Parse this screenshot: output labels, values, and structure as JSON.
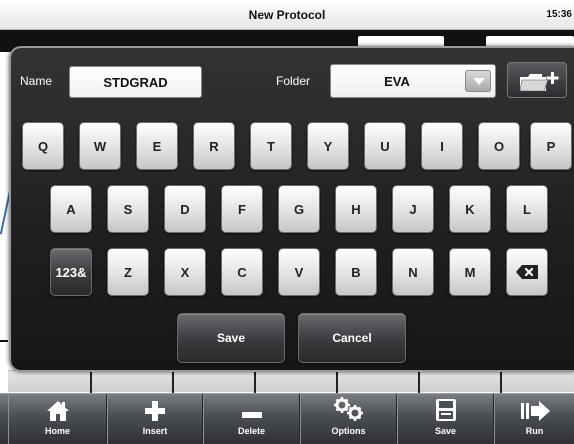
{
  "window": {
    "title": "New Protocol",
    "clock": "15:36"
  },
  "dialog": {
    "name_label": "Name",
    "name_value": "STDGRAD",
    "folder_label": "Folder",
    "folder_value": "EVA",
    "icons": {
      "dropdown": "chevron-down-icon",
      "new_folder": "new-folder-icon"
    }
  },
  "keyboard": {
    "row1": [
      "Q",
      "W",
      "E",
      "R",
      "T",
      "Y",
      "U",
      "I",
      "O",
      "P"
    ],
    "row2": [
      "A",
      "S",
      "D",
      "F",
      "G",
      "H",
      "J",
      "K",
      "L"
    ],
    "row3": [
      "Z",
      "X",
      "C",
      "V",
      "B",
      "N",
      "M"
    ],
    "mode_key": "123&",
    "backspace_icon": "backspace-icon",
    "save_label": "Save",
    "cancel_label": "Cancel"
  },
  "toolbar": {
    "items": [
      {
        "label": "Home",
        "icon": "home-icon"
      },
      {
        "label": "Insert",
        "icon": "plus-icon"
      },
      {
        "label": "Delete",
        "icon": "minus-icon"
      },
      {
        "label": "Options",
        "icon": "gears-icon"
      },
      {
        "label": "Save",
        "icon": "floppy-disk-icon"
      },
      {
        "label": "Run",
        "icon": "play-arrow-icon"
      }
    ]
  },
  "colors": {
    "dialog_bg": "#1f1f22",
    "key_face": "#e2e2e2",
    "toolbar_bg": "#4a4d52"
  }
}
